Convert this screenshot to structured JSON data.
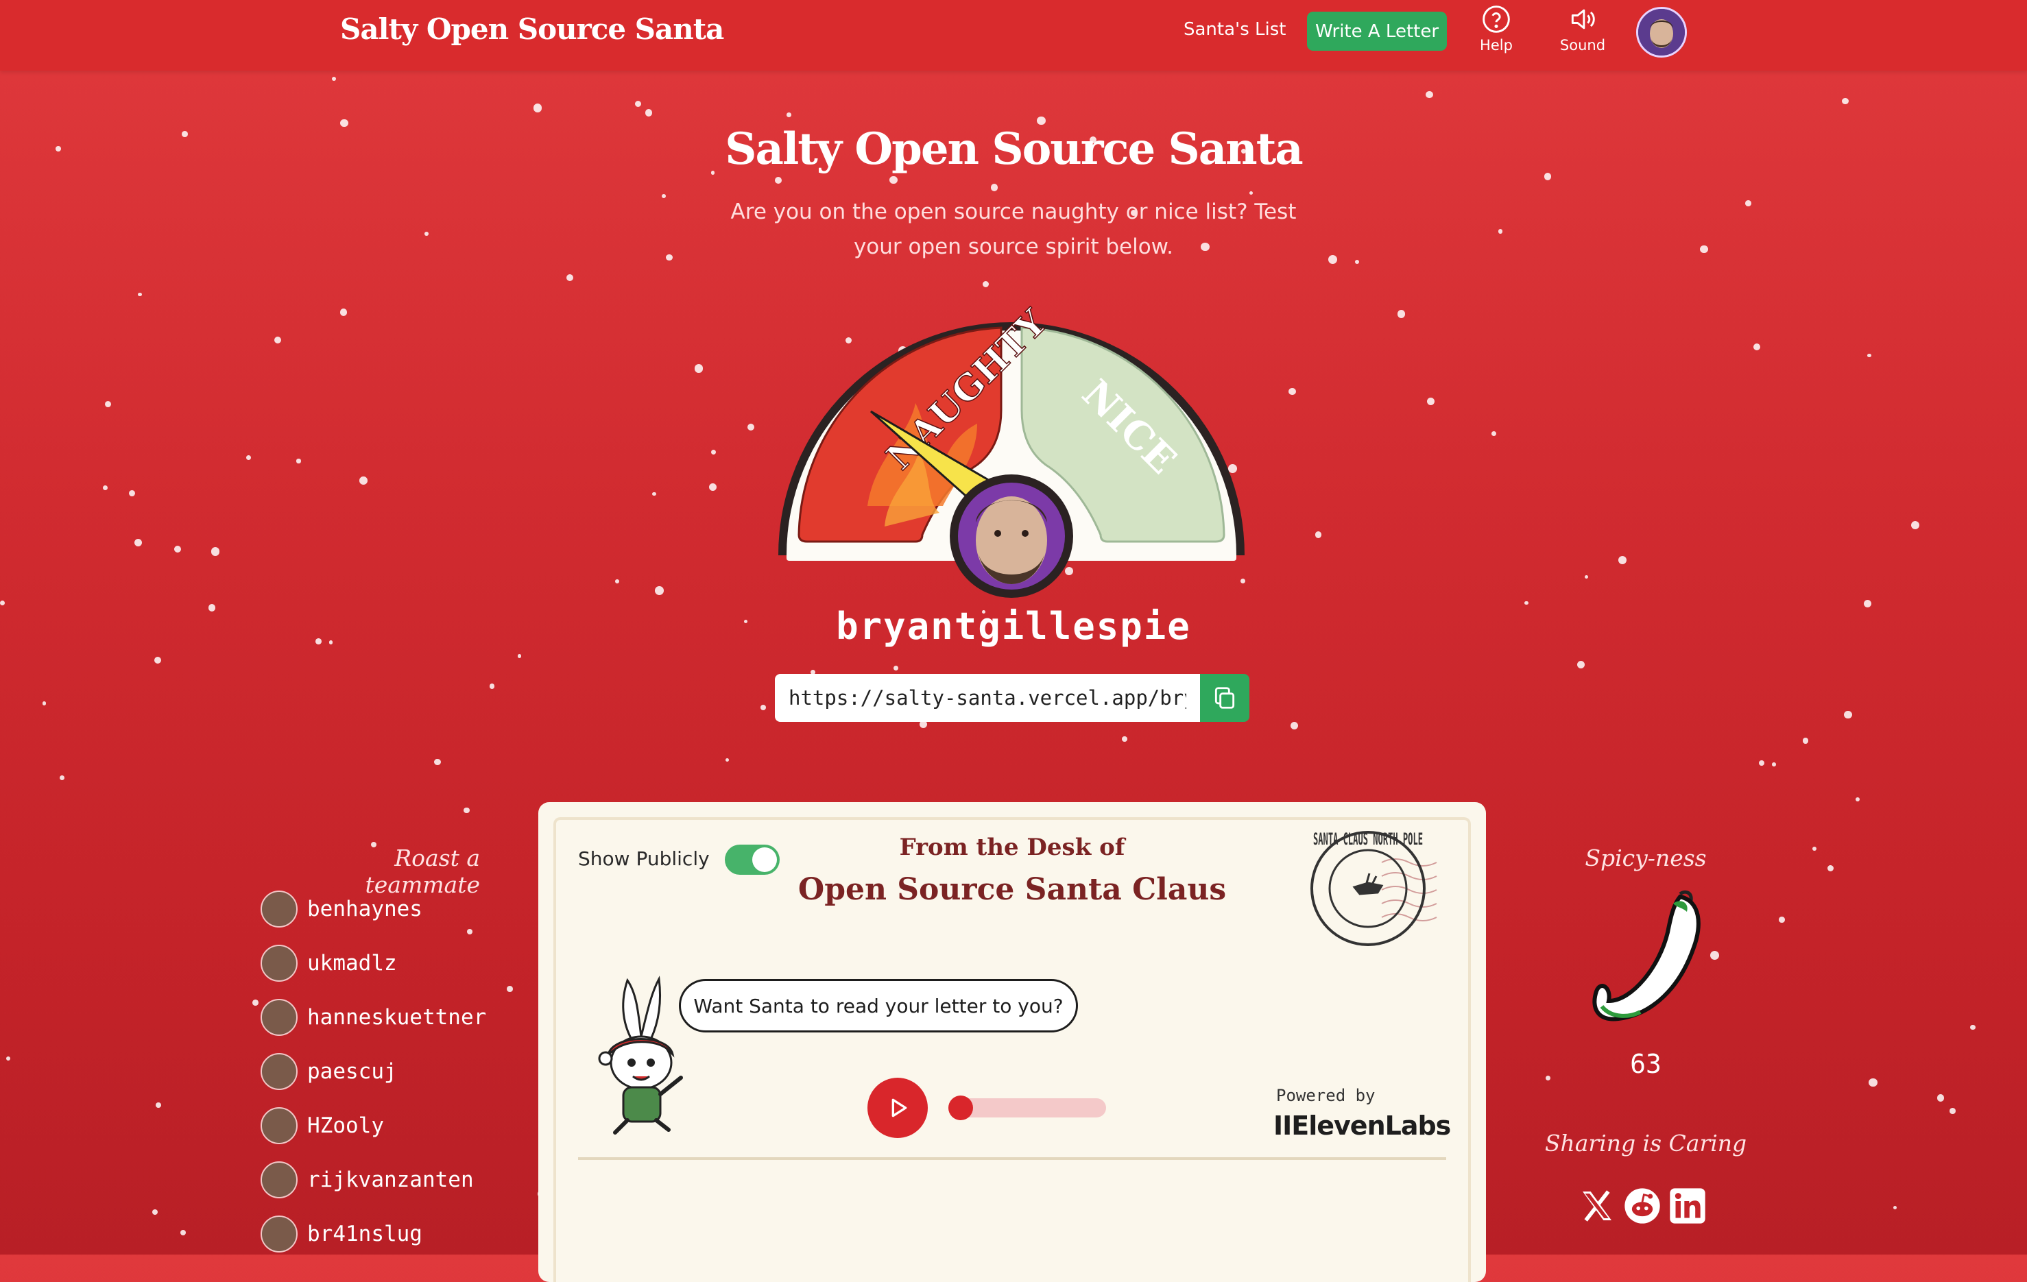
{
  "header": {
    "brand": "Salty Open Source Santa",
    "nav_list": "Santa's List",
    "write_button": "Write A Letter",
    "help_label": "Help",
    "sound_label": "Sound",
    "help_icon": "question-circle-icon",
    "sound_icon": "speaker-icon"
  },
  "hero": {
    "title": "Salty Open Source Santa",
    "subtitle": "Are you on the open source naughty or nice list? Test your open source spirit below."
  },
  "meter": {
    "naughty_label": "NAUGHTY",
    "nice_label": "NICE",
    "needle_level": 0.18
  },
  "profile": {
    "username": "bryantgillespie",
    "share_url": "https://salty-santa.vercel.app/bryantgillespie"
  },
  "roast": {
    "title": "Roast a teammate",
    "teammates": [
      "benhaynes",
      "ukmadlz",
      "hanneskuettner",
      "paescuj",
      "HZooly",
      "rijkvanzanten",
      "br41nslug"
    ]
  },
  "letter": {
    "show_publicly": "Show Publicly",
    "show_publicly_on": true,
    "desk_line1": "From the Desk of",
    "desk_line2": "Open Source Santa Claus",
    "stamp_text": "SANTA CLAUS NORTH POLE",
    "bubble": "Want Santa to read your letter to you?",
    "powered_by": "Powered by",
    "provider": "IIElevenLabs",
    "audio_progress": 0.0
  },
  "spicy": {
    "title": "Spicy-ness",
    "value": "63"
  },
  "share": {
    "title": "Sharing is Caring",
    "icons": [
      "x-icon",
      "reddit-icon",
      "linkedin-icon"
    ]
  },
  "colors": {
    "brand_red": "#d92b2d",
    "accent_green": "#2fa85c",
    "card_bg": "#fbf7ec",
    "naughty": "#e13b2e",
    "nice": "#d3e3c4"
  }
}
